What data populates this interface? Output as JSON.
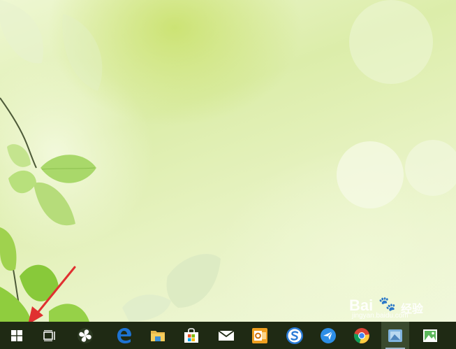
{
  "watermark": {
    "brand": "Bai",
    "cn": "经验",
    "url": "jingyan.baidu.com",
    "paw": "🐾"
  },
  "taskbar": {
    "items": [
      {
        "name": "start-button",
        "icon": "windows-logo-icon"
      },
      {
        "name": "task-view-button",
        "icon": "task-view-icon"
      },
      {
        "name": "app-pinwheel-button",
        "icon": "pinwheel-icon"
      },
      {
        "name": "edge-button",
        "icon": "edge-icon"
      },
      {
        "name": "file-explorer-button",
        "icon": "folder-icon"
      },
      {
        "name": "store-button",
        "icon": "store-bag-icon"
      },
      {
        "name": "mail-button",
        "icon": "envelope-icon"
      },
      {
        "name": "outlook-button",
        "icon": "outlook-icon"
      },
      {
        "name": "sogou-button",
        "icon": "sogou-s-icon"
      },
      {
        "name": "feige-button",
        "icon": "bird-icon"
      },
      {
        "name": "chrome-button",
        "icon": "chrome-icon"
      },
      {
        "name": "app-blue-button",
        "icon": "blue-app-icon"
      },
      {
        "name": "photos-button",
        "icon": "photos-icon"
      }
    ]
  },
  "colors": {
    "taskbar": "#1f2a14",
    "arrow": "#e03030",
    "leaf": "#8fcd4a",
    "edge_blue": "#1e73d2"
  }
}
